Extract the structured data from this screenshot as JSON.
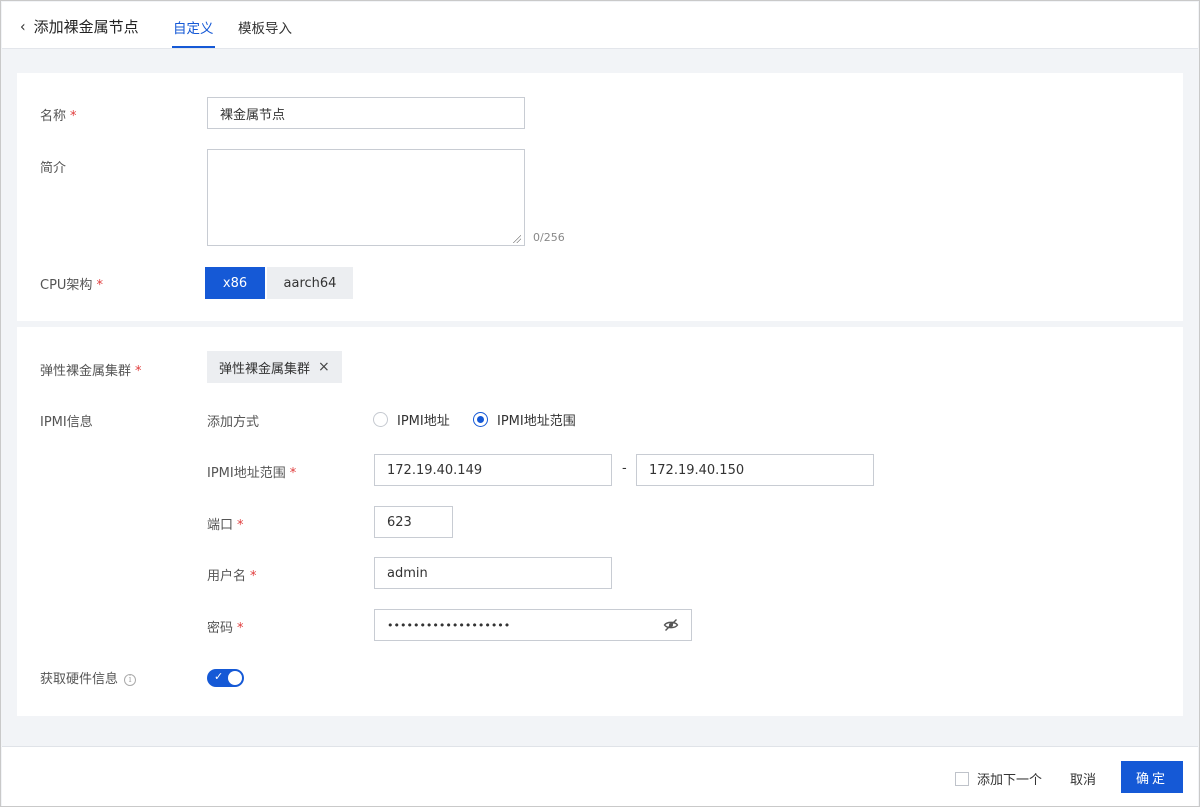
{
  "header": {
    "back_title": "添加裸金属节点",
    "tabs": [
      {
        "label": "自定义",
        "active": true
      },
      {
        "label": "模板导入",
        "active": false
      }
    ]
  },
  "form": {
    "name": {
      "label": "名称",
      "value": "裸金属节点",
      "required": true
    },
    "description": {
      "label": "简介",
      "value": "",
      "counter": "0/256"
    },
    "cpu_arch": {
      "label": "CPU架构",
      "required": true,
      "options": [
        "x86",
        "aarch64"
      ],
      "selected": "x86"
    },
    "cluster": {
      "label": "弹性裸金属集群",
      "required": true,
      "tag": "弹性裸金属集群",
      "remove_glyph": "×"
    },
    "ipmi": {
      "label": "IPMI信息",
      "add_method": {
        "label": "添加方式",
        "options": [
          "IPMI地址",
          "IPMI地址范围"
        ],
        "selected": "IPMI地址范围"
      },
      "range": {
        "label": "IPMI地址范围",
        "required": true,
        "start": "172.19.40.149",
        "separator": "-",
        "end": "172.19.40.150"
      },
      "port": {
        "label": "端口",
        "required": true,
        "value": "623"
      },
      "username": {
        "label": "用户名",
        "required": true,
        "value": "admin"
      },
      "password": {
        "label": "密码",
        "required": true,
        "value": "•••••••••••••••••••"
      }
    },
    "hardware_info": {
      "label": "获取硬件信息",
      "enabled": true
    }
  },
  "footer": {
    "add_next_label": "添加下一个",
    "add_next_checked": false,
    "cancel_label": "取消",
    "confirm_label": "确定"
  },
  "colors": {
    "accent": "#1559d6",
    "required": "#e03b3b"
  }
}
